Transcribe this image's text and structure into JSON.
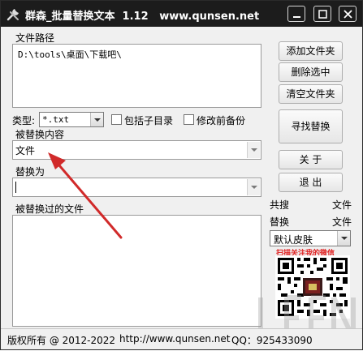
{
  "window": {
    "title": "群森_批量替换文本  1.12   www.qunsen.net"
  },
  "path_section": {
    "label": "文件路径",
    "content": "D:\\tools\\桌面\\下载吧\\"
  },
  "buttons": {
    "add_folder": "添加文件夹",
    "delete_selected": "删除选中",
    "clear_folders": "清空文件夹",
    "find_replace": "寻找替换",
    "about": "关  于",
    "exit": "退  出"
  },
  "filters": {
    "type_label": "类型:",
    "type_value": "*.txt",
    "include_subdirs_label": "包括子目录",
    "include_subdirs_checked": false,
    "backup_label": "修改前备份",
    "backup_checked": false
  },
  "find_section": {
    "label": "被替换内容",
    "value": "文件"
  },
  "replace_section": {
    "label": "替换为",
    "value": ""
  },
  "replaced_files": {
    "label": "被替换过的文件"
  },
  "stats": {
    "searched_label": "共搜",
    "searched_unit": "文件",
    "replaced_label": "替换",
    "replaced_unit": "文件"
  },
  "skin": {
    "selected": "默认皮肤"
  },
  "qr": {
    "caption": "扫描关注我的微信"
  },
  "footer": {
    "copyright": "版权所有 @ 2012-2022",
    "website": "http://www.qunsen.net",
    "qq": "QQ：925433090"
  },
  "colors": {
    "titlebar": "#1c1c1c",
    "arrow": "#d12a2a",
    "qr_caption": "#e02020"
  }
}
